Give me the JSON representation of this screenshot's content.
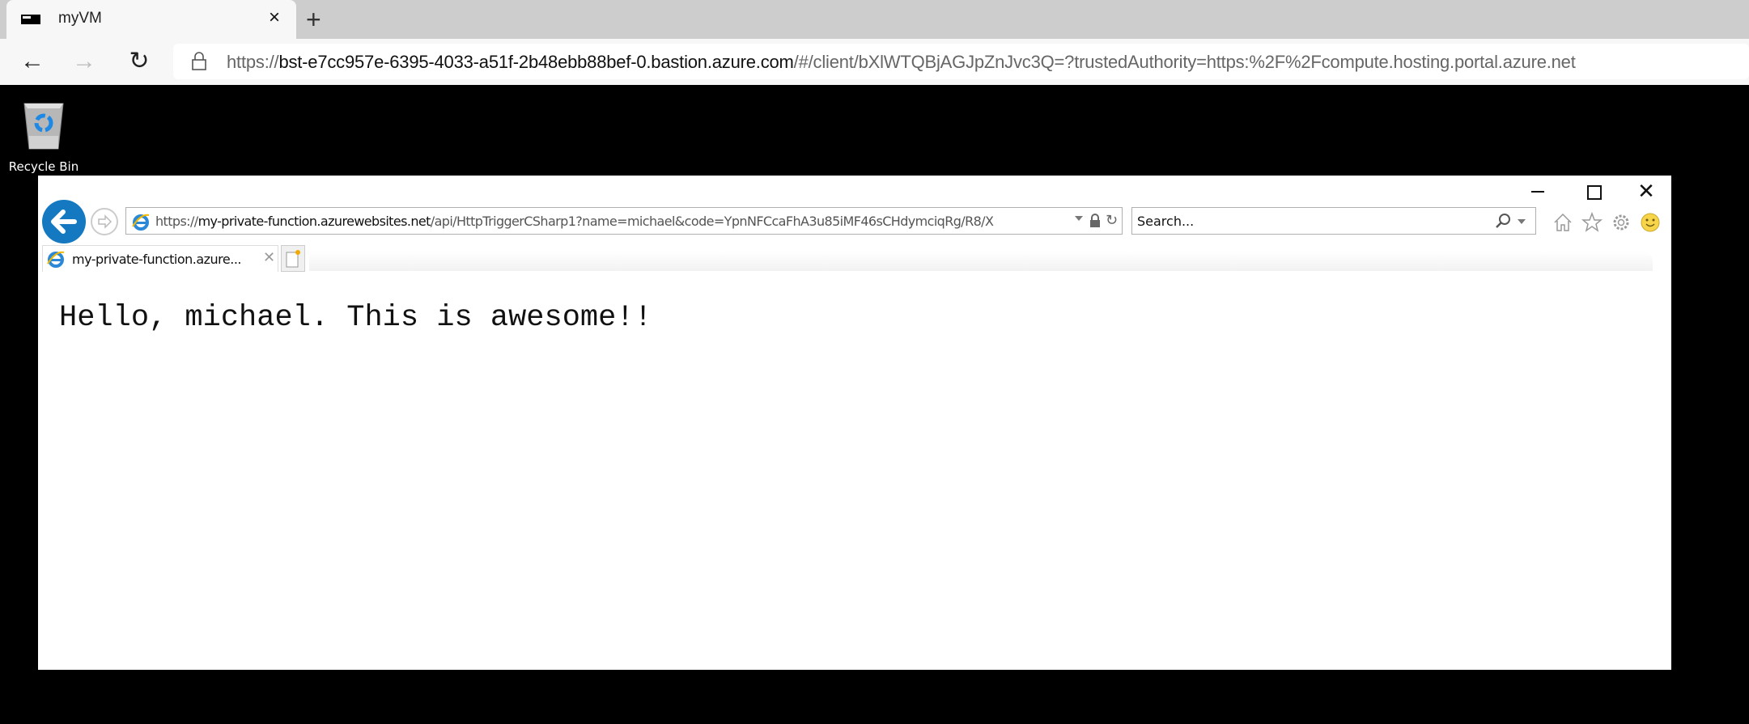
{
  "edge": {
    "tab": {
      "title": "myVM",
      "favicon": "vm-console-icon",
      "close_icon": "close-icon"
    },
    "new_tab_icon": "plus-icon",
    "nav": {
      "back_icon": "arrow-left-icon",
      "forward_icon": "arrow-right-icon",
      "reload_icon": "refresh-icon"
    },
    "address": {
      "lock_icon": "lock-icon",
      "scheme": "https://",
      "host": "bst-e7cc957e-6395-4033-a51f-2b48ebb88bef-0.bastion.azure.com",
      "path": "/#/client/bXlWTQBjAGJpZnJvc3Q=?trustedAuthority=https:%2F%2Fcompute.hosting.portal.azure.net"
    }
  },
  "desktop": {
    "icons": [
      {
        "label": "Recycle Bin",
        "icon": "recycle-bin-icon"
      }
    ]
  },
  "ie": {
    "window_controls": {
      "minimize": "minimize-icon",
      "maximize": "maximize-icon",
      "close": "close-icon"
    },
    "address": {
      "scheme": "https://",
      "host": "my-private-function.azurewebsites.net",
      "path": "/api/HttpTriggerCSharp1?name=michael&code=YpnNFCcaFhA3u85iMF46sCHdymciqRg/R8/X"
    },
    "search": {
      "placeholder": "Search...",
      "value": ""
    },
    "toolbar_icons": [
      "home-icon",
      "star-icon",
      "gear-icon",
      "smiley-icon"
    ],
    "tab": {
      "title": "my-private-function.azure..."
    },
    "page": {
      "body_text": "Hello, michael. This is awesome!!"
    }
  }
}
